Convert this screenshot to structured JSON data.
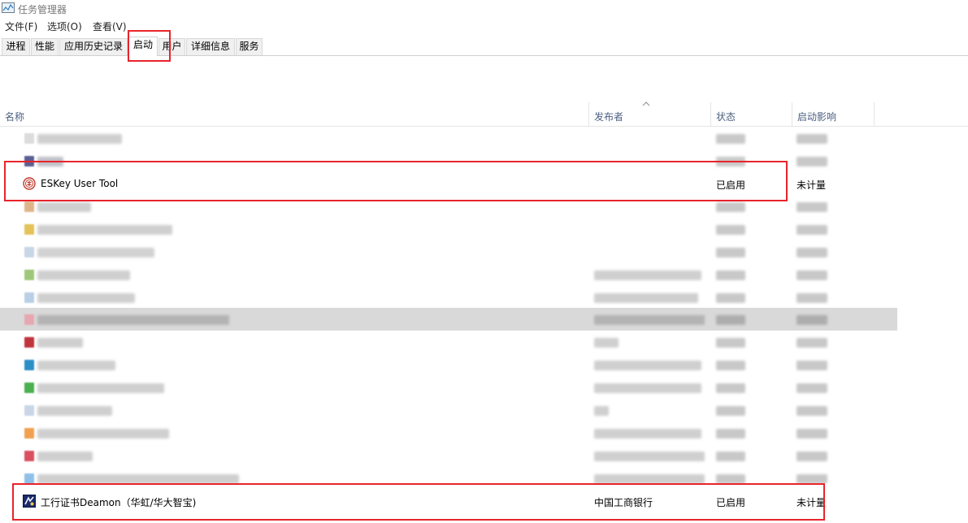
{
  "window": {
    "title": "任务管理器"
  },
  "menu": [
    "文件(F)",
    "选项(O)",
    "查看(V)"
  ],
  "tabs": [
    "进程",
    "性能",
    "应用历史记录",
    "启动",
    "用户",
    "详细信息",
    "服务"
  ],
  "active_tab": "启动",
  "columns": {
    "name": "名称",
    "publisher": "发布者",
    "status": "状态",
    "impact": "启动影响"
  },
  "rows": [
    {
      "name": "ESKey User Tool",
      "publisher": "",
      "status": "已启用",
      "impact": "未计量",
      "icon": "eskey-icon"
    },
    {
      "name": "工行证书Deamon（华虹/华大智宝)",
      "publisher": "中国工商银行",
      "status": "已启用",
      "impact": "未计量",
      "icon": "icbc-cert-icon"
    }
  ],
  "highlights": [
    "tab-startup",
    "row-eskey-user-tool",
    "row-icbc-cert-deamon"
  ],
  "colors": {
    "highlight_box": "#e8242b",
    "header_text": "#4d6082",
    "selected_row": "#d9d9d9"
  }
}
